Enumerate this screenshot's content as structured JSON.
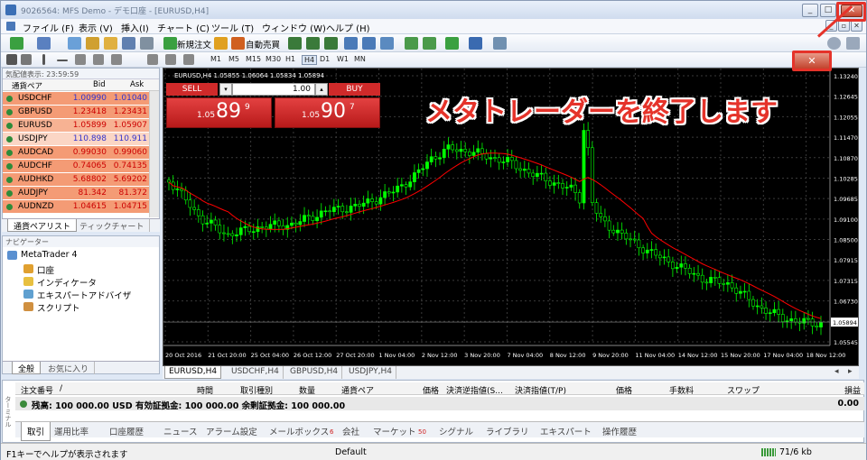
{
  "window": {
    "title": "9026564: MFS Demo - デモ口座 - [EURUSD,H4]"
  },
  "menu": [
    "ファイル (F)",
    "表示 (V)",
    "挿入(I)",
    "チャート (C)",
    "ツール (T)",
    "ウィンドウ (W)",
    "ヘルプ (H)"
  ],
  "toolbar": {
    "new_order": "新規注文",
    "auto_trading": "自動売買",
    "timeframes": [
      "M1",
      "M5",
      "M15",
      "M30",
      "H1",
      "H4",
      "D1",
      "W1",
      "MN"
    ],
    "active_timeframe": "H4"
  },
  "market_watch": {
    "header": "気配値表示: 23:59:59",
    "columns": {
      "symbol": "通貨ペア",
      "bid": "Bid",
      "ask": "Ask"
    },
    "rows": [
      {
        "symbol": "USDCHF",
        "bid": "1.00990",
        "ask": "1.01040",
        "color": "#3333cc"
      },
      {
        "symbol": "GBPUSD",
        "bid": "1.23418",
        "ask": "1.23431",
        "color": "#cc0000"
      },
      {
        "symbol": "EURUSD",
        "bid": "1.05899",
        "ask": "1.05907",
        "color": "#cc0000"
      },
      {
        "symbol": "USDJPY",
        "bid": "110.898",
        "ask": "110.911",
        "color": "#3333cc"
      },
      {
        "symbol": "AUDCAD",
        "bid": "0.99030",
        "ask": "0.99060",
        "color": "#cc0000"
      },
      {
        "symbol": "AUDCHF",
        "bid": "0.74065",
        "ask": "0.74135",
        "color": "#cc0000"
      },
      {
        "symbol": "AUDHKD",
        "bid": "5.68802",
        "ask": "5.69202",
        "color": "#cc0000"
      },
      {
        "symbol": "AUDJPY",
        "bid": "81.342",
        "ask": "81.372",
        "color": "#cc0000"
      },
      {
        "symbol": "AUDNZD",
        "bid": "1.04615",
        "ask": "1.04715",
        "color": "#cc0000"
      }
    ],
    "tabs": [
      "通貨ペアリスト",
      "ティックチャート"
    ]
  },
  "navigator": {
    "header": "ナビゲーター",
    "root": "MetaTrader 4",
    "items": [
      "口座",
      "インディケータ",
      "エキスパートアドバイザ",
      "スクリプト"
    ],
    "tabs": [
      "全般",
      "お気に入り"
    ]
  },
  "chart": {
    "info": "EURUSD,H4  1.05855 1.06064 1.05834 1.05894",
    "one_click": {
      "sell": "SELL",
      "buy": "BUY",
      "lot": "1.00",
      "sell_small": "1.05",
      "sell_big": "89",
      "sell_sup": "9",
      "buy_small": "1.05",
      "buy_big": "90",
      "buy_sup": "7"
    },
    "price_labels": [
      "1.13240",
      "1.12645",
      "1.12055",
      "1.11470",
      "1.10870",
      "1.10285",
      "1.09685",
      "1.09100",
      "1.08500",
      "1.07915",
      "1.07315",
      "1.06730",
      "1.06130",
      "1.05545"
    ],
    "current_price": "1.05894",
    "time_labels": [
      "20 Oct 2016",
      "21 Oct 20:00",
      "25 Oct 04:00",
      "26 Oct 12:00",
      "27 Oct 20:00",
      "1 Nov 04:00",
      "2 Nov 12:00",
      "3 Nov 20:00",
      "7 Nov 04:00",
      "8 Nov 12:00",
      "9 Nov 20:00",
      "11 Nov 04:00",
      "14 Nov 12:00",
      "15 Nov 20:00",
      "17 Nov 04:00",
      "18 Nov 12:00"
    ],
    "tabs": [
      "EURUSD,H4",
      "USDCHF,H4",
      "GBPUSD,H4",
      "USDJPY,H4"
    ]
  },
  "caption": "メタトレーダーを終了します",
  "terminal": {
    "columns": [
      "注文番号",
      "/",
      "時間",
      "取引種別",
      "数量",
      "通貨ペア",
      "価格",
      "決済逆指値(S...",
      "決済指値(T/P)",
      "価格",
      "手数料",
      "スワップ",
      "損益"
    ],
    "balance_line": "残高: 100 000.00 USD  有効証拠金: 100 000.00  余剰証拠金: 100 000.00",
    "balance_value": "0.00",
    "side_label": "ターミナル",
    "tabs": [
      "取引",
      "運用比率",
      "口座履歴",
      "ニュース",
      "アラーム設定",
      "メールボックス",
      "会社",
      "マーケット",
      "シグナル",
      "ライブラリ",
      "エキスパート",
      "操作履歴"
    ],
    "mailbox_count": "6",
    "market_count": "50"
  },
  "statusbar": {
    "help": "F1キーでヘルプが表示されます",
    "profile": "Default",
    "traffic": "71/6 kb"
  },
  "close_symbol": "✕",
  "colors": {
    "accent_red": "#e5332a",
    "chart_bg": "#000000",
    "candle": "#00ff00",
    "ma": "#ff0000"
  }
}
